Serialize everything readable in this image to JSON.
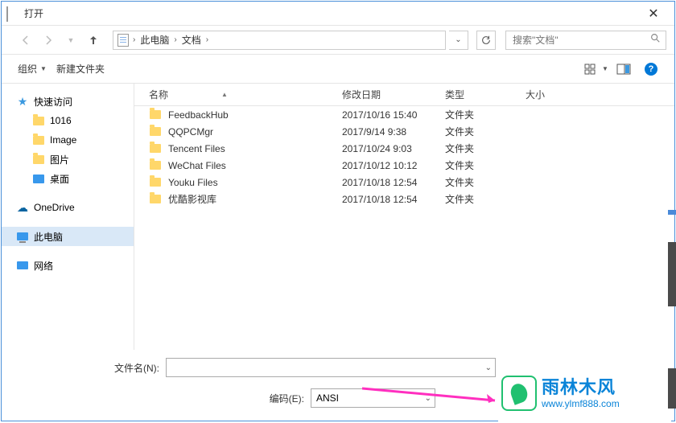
{
  "window": {
    "title": "打开"
  },
  "nav": {
    "path": [
      "此电脑",
      "文档"
    ],
    "search_placeholder": "搜索\"文档\""
  },
  "toolbar": {
    "organize": "组织",
    "newfolder": "新建文件夹"
  },
  "sidebar": {
    "quick": "快速访问",
    "items": [
      {
        "label": "1016"
      },
      {
        "label": "Image"
      },
      {
        "label": "图片"
      },
      {
        "label": "桌面"
      }
    ],
    "onedrive": "OneDrive",
    "thispc": "此电脑",
    "network": "网络"
  },
  "columns": {
    "name": "名称",
    "date": "修改日期",
    "type": "类型",
    "size": "大小"
  },
  "files": [
    {
      "name": "FeedbackHub",
      "date": "2017/10/16 15:40",
      "type": "文件夹"
    },
    {
      "name": "QQPCMgr",
      "date": "2017/9/14 9:38",
      "type": "文件夹"
    },
    {
      "name": "Tencent Files",
      "date": "2017/10/24 9:03",
      "type": "文件夹"
    },
    {
      "name": "WeChat Files",
      "date": "2017/10/12 10:12",
      "type": "文件夹"
    },
    {
      "name": "Youku Files",
      "date": "2017/10/18 12:54",
      "type": "文件夹"
    },
    {
      "name": "优酷影视库",
      "date": "2017/10/18 12:54",
      "type": "文件夹"
    }
  ],
  "bottom": {
    "filename_label": "文件名(N):",
    "filename_value": "",
    "encoding_label": "编码(E):",
    "encoding_value": "ANSI"
  },
  "watermark": {
    "text": "雨林木风",
    "url": "www.ylmf888.com"
  }
}
